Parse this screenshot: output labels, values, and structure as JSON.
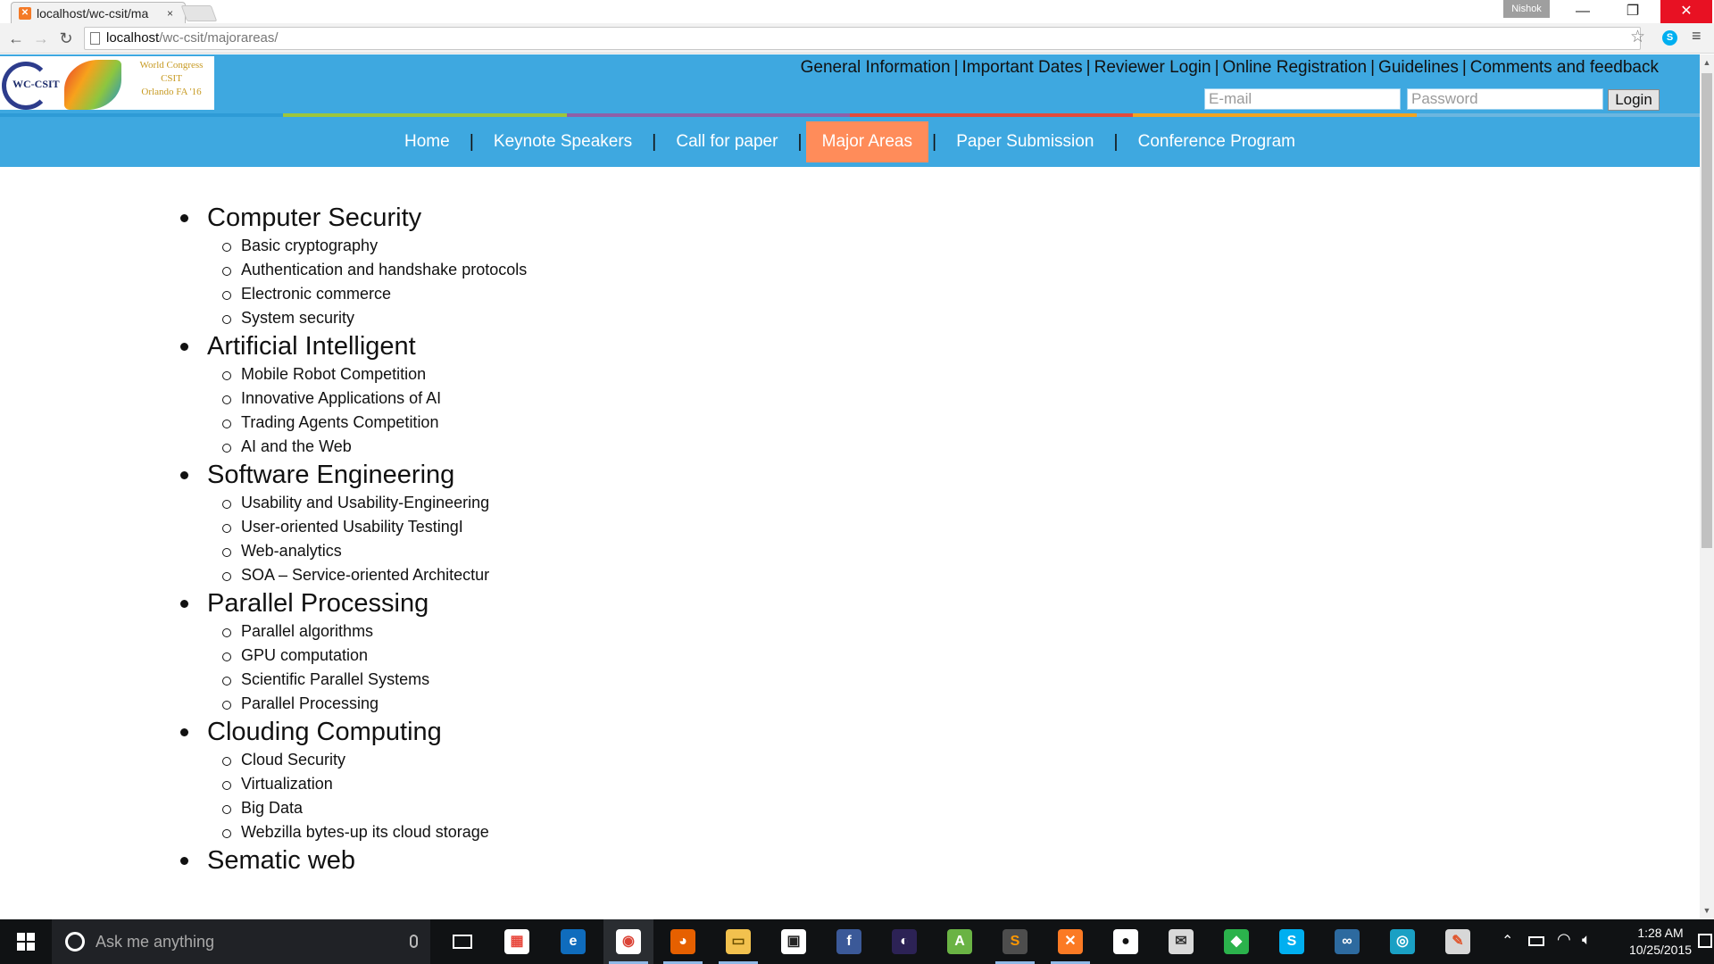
{
  "browser": {
    "tab_title": "localhost/wc-csit/ma",
    "tab_close": "×",
    "profile_name": "Nishok",
    "url_host": "localhost",
    "url_path": "/wc-csit/majorareas/",
    "window_controls": [
      "minimize",
      "restore",
      "close"
    ]
  },
  "site": {
    "logo": {
      "abbr": "WC-CSIT",
      "line1": "World Congress",
      "line2": "CSIT",
      "line3": "Orlando FA '16"
    },
    "top_links": [
      "General Information",
      "Important Dates",
      "Reviewer Login",
      "Online Registration",
      "Guidelines",
      "Comments and feedback"
    ],
    "login": {
      "email_placeholder": "E-mail",
      "password_placeholder": "Password",
      "login_label": "Login"
    },
    "color_strip": [
      "#2e9bd6",
      "#9dc63b",
      "#8e5fa8",
      "#e24a3b",
      "#f2a41f",
      "#6cb6df"
    ],
    "nav": {
      "home": "Home",
      "keynote": "Keynote Speakers",
      "call": "Call for paper",
      "major": "Major Areas",
      "submission": "Paper Submission",
      "program": "Conference Program",
      "active": "Major Areas"
    },
    "colors": {
      "header_bg": "#3ea8e0",
      "active_nav_bg": "#ff8c5a"
    }
  },
  "areas": [
    {
      "title": "Computer Security",
      "topics": [
        "Basic cryptography",
        "Authentication and handshake protocols",
        "Electronic commerce",
        "System security"
      ]
    },
    {
      "title": "Artificial Intelligent",
      "topics": [
        "Mobile Robot Competition",
        "Innovative Applications of AI",
        "Trading Agents Competition",
        "AI and the Web"
      ]
    },
    {
      "title": "Software Engineering",
      "topics": [
        "Usability and Usability-Engineering",
        "User-oriented Usability TestingI",
        "Web-analytics",
        "SOA – Service-oriented Architectur"
      ]
    },
    {
      "title": "Parallel Processing",
      "topics": [
        "Parallel algorithms",
        "GPU computation",
        "Scientific Parallel Systems",
        "Parallel Processing"
      ]
    },
    {
      "title": "Clouding Computing",
      "topics": [
        "Cloud Security",
        "Virtualization",
        "Big Data",
        "Webzilla bytes-up its cloud storage"
      ]
    },
    {
      "title": "Sematic web",
      "topics": []
    }
  ],
  "taskbar": {
    "search_text": "Ask me anything",
    "apps": [
      "store-grid",
      "edge",
      "chrome",
      "firefox",
      "file-explorer",
      "windows-store",
      "facebook",
      "eclipse",
      "android-studio",
      "sublime-text",
      "xampp",
      "github",
      "mail",
      "feedly",
      "skype",
      "visual-studio",
      "globe",
      "paint"
    ],
    "time": "1:28 AM",
    "date": "10/25/2015"
  }
}
